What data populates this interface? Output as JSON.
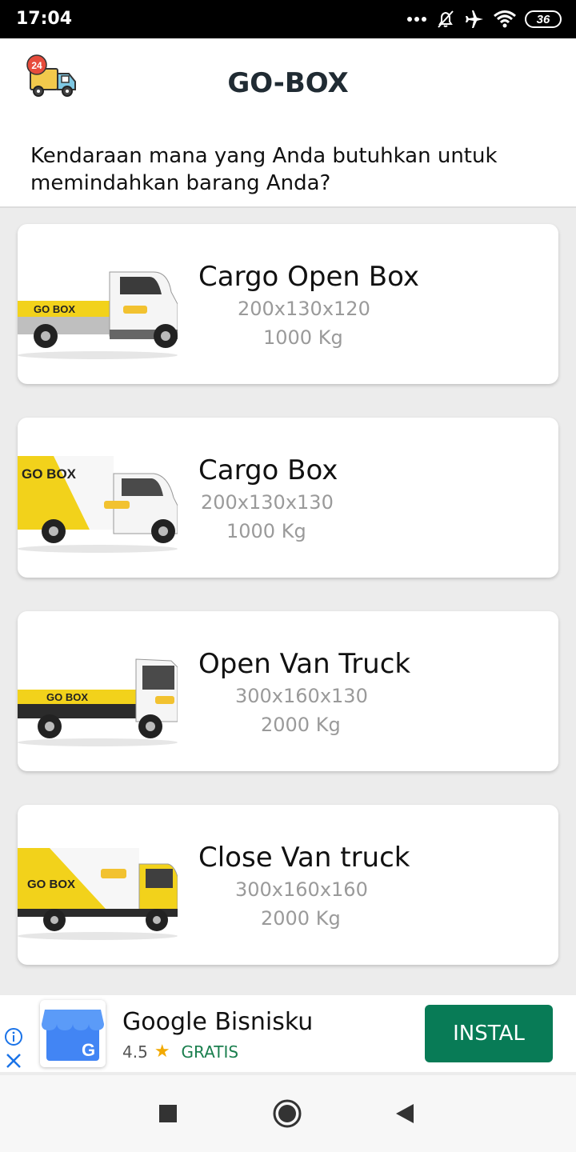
{
  "status_bar": {
    "time": "17:04",
    "battery": "36",
    "icons": [
      "more-icon",
      "alarm-off-icon",
      "airplane-icon",
      "wifi-icon",
      "battery-icon"
    ]
  },
  "header": {
    "title": "GO-BOX",
    "logo_badge": "24",
    "question": "Kendaraan mana yang Anda butuhkan untuk memindahkan barang Anda?"
  },
  "vehicles": [
    {
      "name": "Cargo Open Box",
      "dims": "200x130x120",
      "weight": "1000 Kg",
      "brand": "GO BOX"
    },
    {
      "name": "Cargo Box",
      "dims": "200x130x130",
      "weight": "1000 Kg",
      "brand": "GO BOX"
    },
    {
      "name": "Open Van Truck",
      "dims": "300x160x130",
      "weight": "2000 Kg",
      "brand": "GO BOX"
    },
    {
      "name": "Close Van truck",
      "dims": "300x160x160",
      "weight": "2000 Kg",
      "brand": "GO BOX"
    }
  ],
  "ad": {
    "app_name": "Google Bisnisku",
    "rating": "4.5",
    "price": "GRATIS",
    "install_label": "INSTAL",
    "brand_color": "#087b56"
  },
  "colors": {
    "accent_yellow": "#f2d21b",
    "title_dark": "#202b33"
  }
}
